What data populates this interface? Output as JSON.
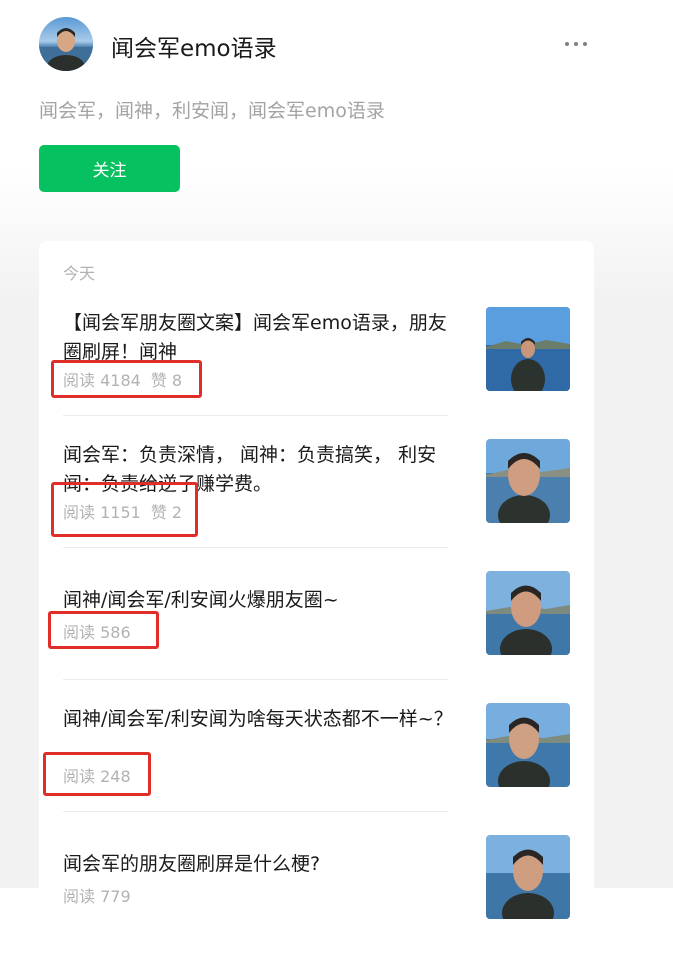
{
  "account": {
    "name": "闻会军emo语录",
    "description": "闻会军，闻神，利安闻，闻会军emo语录",
    "follow_label": "关注",
    "more_icon": "more-dots-icon"
  },
  "feed": {
    "day_label": "今天",
    "articles": [
      {
        "title": "【闻会军朋友圈文案】闻会军emo语录，朋友圈刷屏！闻神",
        "reads": "阅读 4184",
        "likes": "赞 8"
      },
      {
        "title": "闻会军：负责深情， 闻神：负责搞笑， 利安闻：负责给逆子赚学费。",
        "reads": "阅读 1151",
        "likes": "赞 2"
      },
      {
        "title": "闻神/闻会军/利安闻火爆朋友圈~",
        "reads": "阅读 586",
        "likes": ""
      },
      {
        "title": "闻神/闻会军/利安闻为啥每天状态都不一样~？",
        "reads": "阅读 248",
        "likes": ""
      },
      {
        "title": "闻会军的朋友圈刷屏是什么梗?",
        "reads": "阅读 779",
        "likes": ""
      }
    ]
  },
  "colors": {
    "accent": "#07c160",
    "highlight": "#e02d27",
    "muted": "#b2b2b2"
  }
}
